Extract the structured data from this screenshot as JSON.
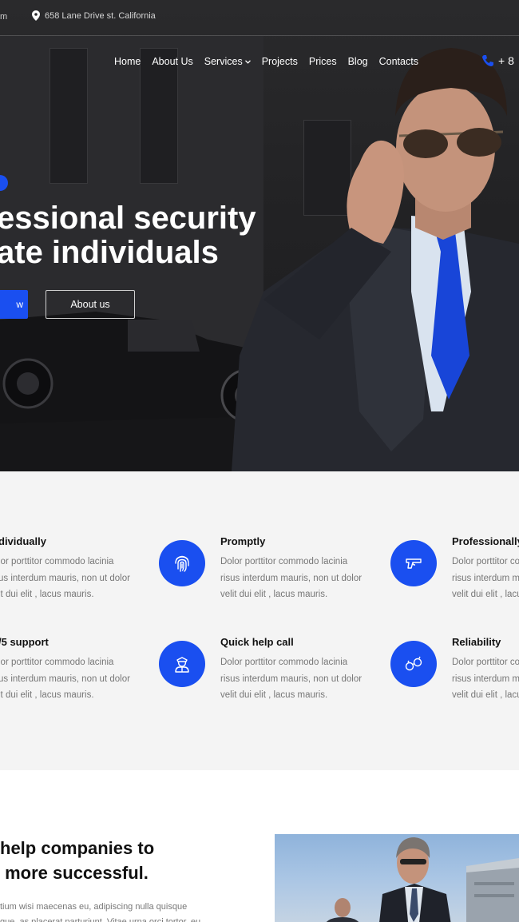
{
  "topbar": {
    "left_fragment": "m",
    "address": "658 Lane Drive st. California"
  },
  "nav": {
    "items": [
      {
        "label": "Home"
      },
      {
        "label": "About Us"
      },
      {
        "label": "Services"
      },
      {
        "label": "Projects"
      },
      {
        "label": "Prices"
      },
      {
        "label": "Blog"
      },
      {
        "label": "Contacts"
      }
    ],
    "phone": "+ 8"
  },
  "hero": {
    "title_line1": "essional security",
    "title_line2": "ate individuals",
    "primary_button": "w",
    "secondary_button": "About us"
  },
  "features": {
    "items": [
      {
        "title": "dividually",
        "text": [
          "lor porttitor commodo lacinia",
          "us interdum mauris, non ut dolor",
          "it dui elit , lacus mauris."
        ]
      },
      {
        "title": "Promptly",
        "text": [
          "Dolor porttitor commodo lacinia",
          "risus interdum mauris, non ut dolor",
          "velit dui elit , lacus mauris."
        ],
        "icon": "fingerprint-icon"
      },
      {
        "title": "Professionally",
        "text": [
          "Dolor porttitor co",
          "risus interdum ma",
          "velit dui elit , lacu"
        ],
        "icon": "pistol-icon"
      },
      {
        "title": "/5 support",
        "text": [
          "lor porttitor commodo lacinia",
          "us interdum mauris, non ut dolor",
          "it dui elit , lacus mauris."
        ]
      },
      {
        "title": "Quick help call",
        "text": [
          "Dolor porttitor commodo lacinia",
          "risus interdum mauris, non ut dolor",
          "velit dui elit , lacus mauris."
        ],
        "icon": "security-guard-icon"
      },
      {
        "title": "Reliability",
        "text": [
          "Dolor porttitor co",
          "risus interdum ma",
          "velit dui elit , lacu"
        ],
        "icon": "handcuffs-icon"
      }
    ]
  },
  "about": {
    "title_line1": "help companies to",
    "title_line2": " more successful.",
    "text_line1": "tium wisi maecenas eu, adipiscing nulla quisque",
    "text_line2": "gue, as placerat parturiunt. Vitae urna orci tortor, eu"
  },
  "colors": {
    "accent": "#1a4ff0",
    "hero_dark": "#1b1b1d",
    "features_bg": "#f4f4f4",
    "muted_text": "#777777"
  }
}
